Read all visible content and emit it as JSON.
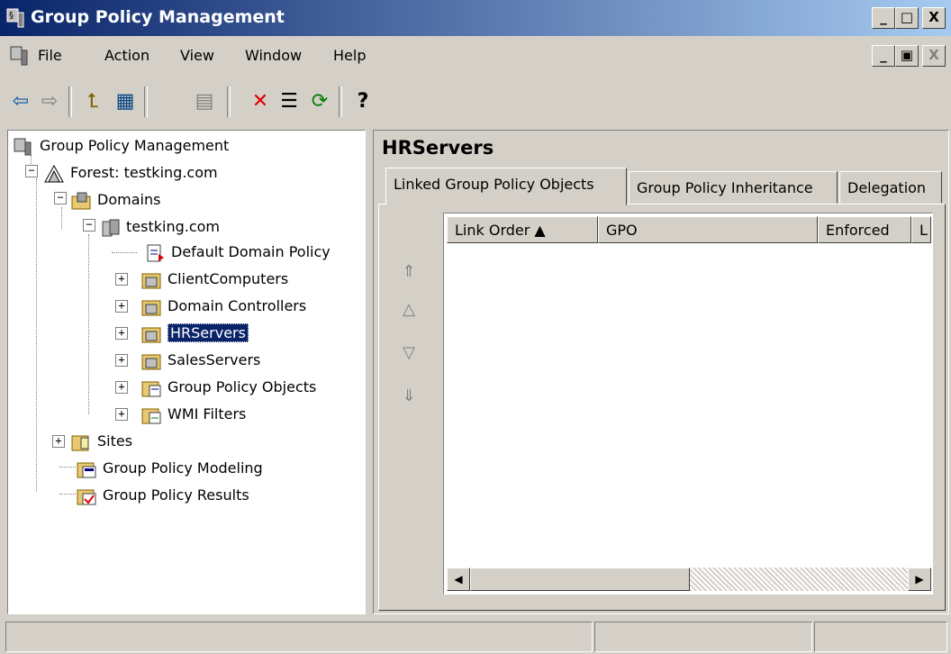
{
  "window": {
    "title": "Group Policy Management"
  },
  "title_buttons": [
    "_",
    "□",
    "X"
  ],
  "menu": {
    "items": [
      {
        "label": "File"
      },
      {
        "label": "Action"
      },
      {
        "label": "View"
      },
      {
        "label": "Window"
      },
      {
        "label": "Help"
      }
    ],
    "mdi_buttons": [
      "_",
      "▣",
      "X"
    ]
  },
  "toolbar": {
    "buttons": [
      {
        "icon": "back-arrow-icon",
        "glyph": "⇦"
      },
      {
        "icon": "forward-arrow-icon",
        "glyph": "⇨"
      },
      {
        "icon": "up-folder-icon",
        "glyph": "⮤"
      },
      {
        "icon": "show-hide-tree-icon",
        "glyph": "▦"
      },
      {
        "icon": "copy-icon",
        "glyph": "▤"
      },
      {
        "icon": "delete-icon",
        "glyph": "✕"
      },
      {
        "icon": "properties-icon",
        "glyph": "☰"
      },
      {
        "icon": "refresh-icon",
        "glyph": "⟳"
      },
      {
        "icon": "help-icon",
        "glyph": "?"
      }
    ]
  },
  "tree": {
    "items": [
      {
        "label": "Group Policy Management",
        "icon": "gpmc-icon"
      },
      {
        "label": "Forest: testking.com",
        "icon": "forest-icon"
      },
      {
        "label": "Domains",
        "icon": "domains-icon"
      },
      {
        "label": "testking.com",
        "icon": "domain-icon"
      },
      {
        "label": "Default Domain Policy",
        "icon": "gpo-link-icon"
      },
      {
        "label": "ClientComputers",
        "icon": "ou-icon"
      },
      {
        "label": "Domain Controllers",
        "icon": "ou-icon"
      },
      {
        "label": "HRServers",
        "icon": "ou-icon"
      },
      {
        "label": "SalesServers",
        "icon": "ou-icon"
      },
      {
        "label": "Group Policy Objects",
        "icon": "gpo-folder-icon"
      },
      {
        "label": "WMI Filters",
        "icon": "wmi-folder-icon"
      },
      {
        "label": "Sites",
        "icon": "sites-icon"
      },
      {
        "label": "Group Policy Modeling",
        "icon": "modeling-icon"
      },
      {
        "label": "Group Policy Results",
        "icon": "results-icon"
      }
    ]
  },
  "right_pane": {
    "title": "HRServers",
    "tabs": [
      {
        "label": "Linked Group Policy Objects"
      },
      {
        "label": "Group Policy Inheritance"
      },
      {
        "label": "Delegation"
      }
    ],
    "columns": [
      {
        "label": "Link Order ▲"
      },
      {
        "label": "GPO"
      },
      {
        "label": "Enforced"
      },
      {
        "label": "L"
      }
    ],
    "order_buttons": [
      "⇑",
      "△",
      "▽",
      "⇓"
    ]
  },
  "colors": {
    "title_start": "#0a246a",
    "title_end": "#a6caf0",
    "selection": "#0a246a",
    "face": "#d4d0c8"
  }
}
